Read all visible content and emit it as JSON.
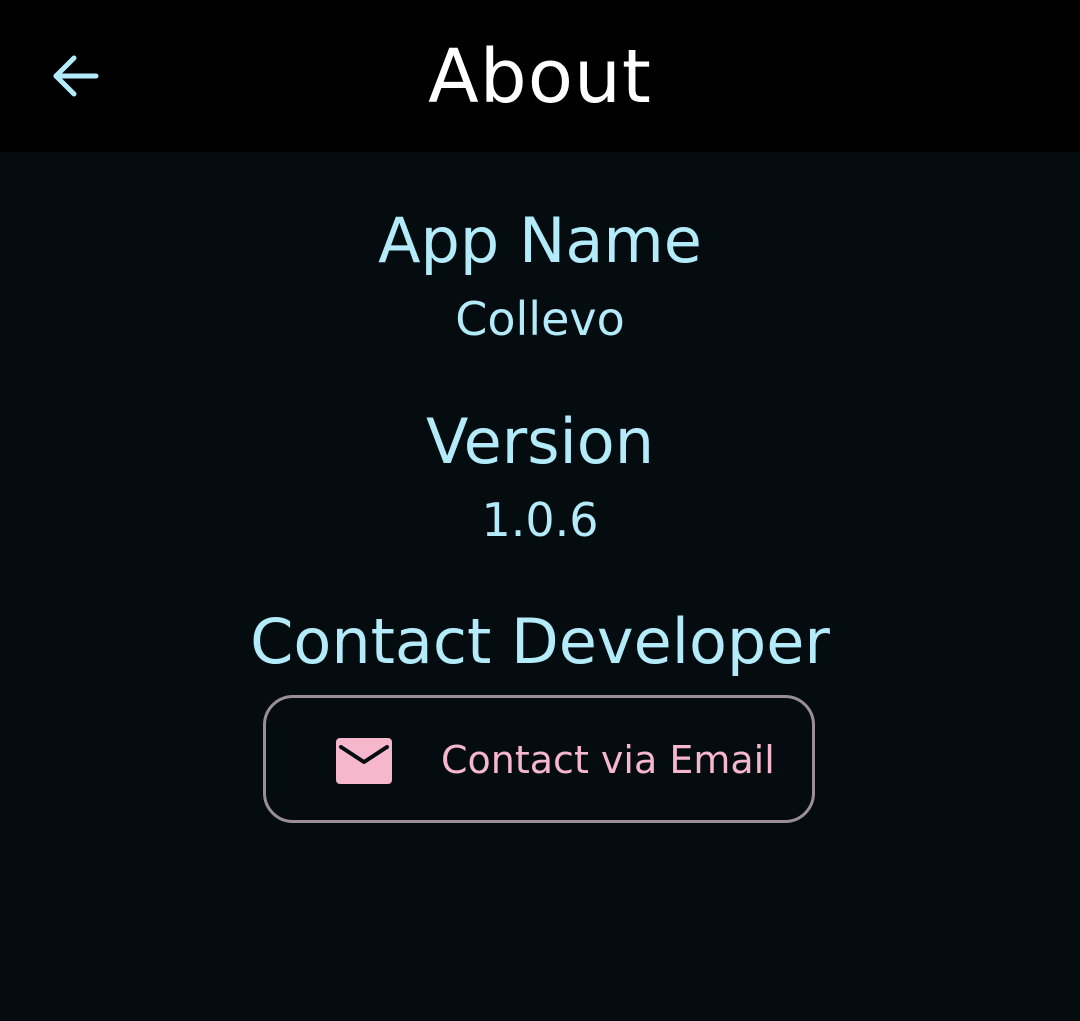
{
  "colors": {
    "accent": "#b3ebfb",
    "button_text": "#f6b6cc",
    "button_border": "#9a8f96",
    "app_bar_bg": "#000000",
    "background": "#040c0f"
  },
  "app_bar": {
    "title": "About",
    "back_icon": "arrow-left-icon"
  },
  "sections": {
    "app_name": {
      "heading": "App Name",
      "value": "Collevo"
    },
    "version": {
      "heading": "Version",
      "value": "1.0.6"
    },
    "contact": {
      "heading": "Contact Developer",
      "button_label": "Contact via Email",
      "button_icon": "mail-icon"
    }
  }
}
